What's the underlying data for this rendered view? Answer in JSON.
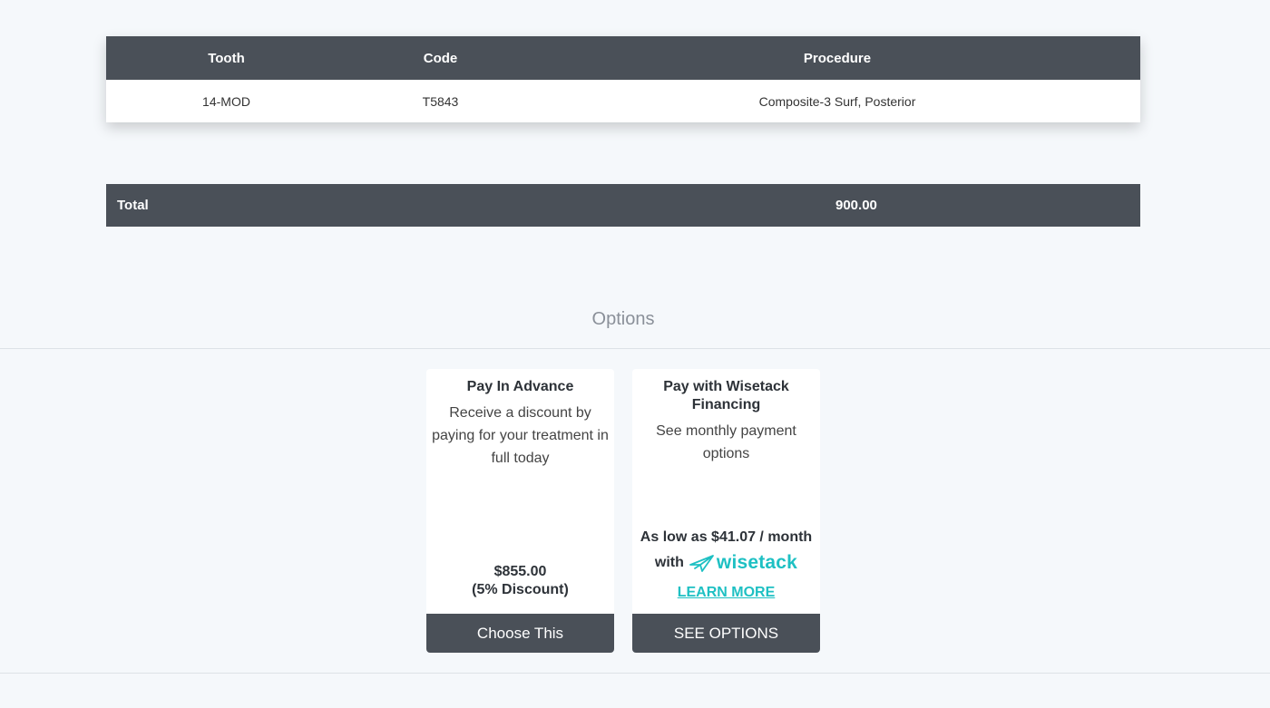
{
  "procedure_table": {
    "headers": {
      "tooth": "Tooth",
      "code": "Code",
      "procedure": "Procedure"
    },
    "rows": [
      {
        "tooth": "14-MOD",
        "code": "T5843",
        "procedure": "Composite-3 Surf, Posterior"
      }
    ]
  },
  "total": {
    "label": "Total",
    "value": "900.00"
  },
  "options": {
    "title": "Options",
    "pay_in_advance": {
      "title": "Pay In Advance",
      "description": "Receive a discount by paying for your treatment in full today",
      "price": "$855.00",
      "discount": "(5% Discount)",
      "button": "Choose This"
    },
    "wisetack": {
      "title": "Pay with Wisetack Financing",
      "description": "See monthly payment options",
      "low_as": "As low as $41.07 / month",
      "with": "with",
      "brand": "wisetack",
      "brand_icon": "paper-plane-icon",
      "learn_more": "LEARN MORE",
      "button": "SEE OPTIONS"
    },
    "brand_color": "#1ec0c3",
    "button_color": "#4a5058"
  }
}
